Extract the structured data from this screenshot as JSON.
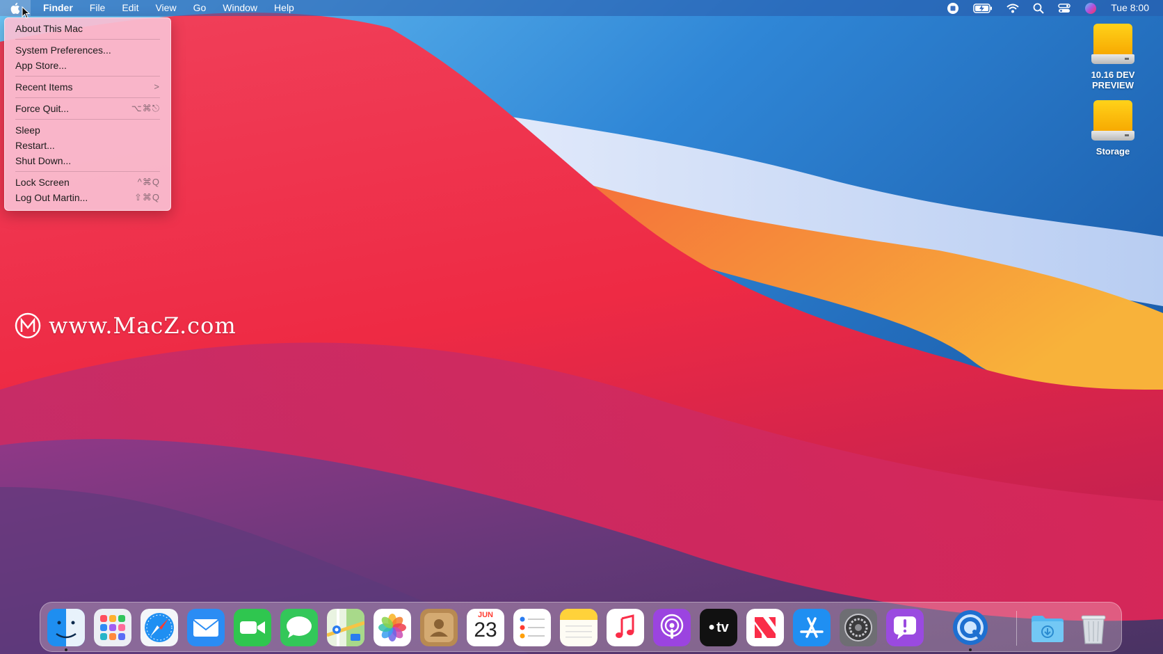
{
  "menubar": {
    "apple_icon": "apple-logo",
    "app_name": "Finder",
    "menus": [
      "File",
      "Edit",
      "View",
      "Go",
      "Window",
      "Help"
    ],
    "status_icons": [
      "record-icon",
      "battery-icon",
      "wifi-icon",
      "spotlight-search-icon",
      "control-center-icon",
      "siri-icon"
    ],
    "clock": "Tue 8:00"
  },
  "apple_menu": {
    "items": [
      {
        "label": "About This Mac",
        "shortcut": ""
      },
      {
        "label": "System Preferences...",
        "shortcut": ""
      },
      {
        "label": "App Store...",
        "shortcut": ""
      },
      {
        "label": "Recent Items",
        "shortcut": ">"
      },
      {
        "label": "Force Quit...",
        "shortcut": "⌥⌘⎋"
      },
      {
        "label": "Sleep",
        "shortcut": ""
      },
      {
        "label": "Restart...",
        "shortcut": ""
      },
      {
        "label": "Shut Down...",
        "shortcut": ""
      },
      {
        "label": "Lock Screen",
        "shortcut": "^⌘Q"
      },
      {
        "label": "Log Out Martin...",
        "shortcut": "⇧⌘Q"
      }
    ]
  },
  "desktop": {
    "drives": [
      {
        "label_line1": "10.16 DEV",
        "label_line2": "PREVIEW"
      },
      {
        "label_line1": "Storage",
        "label_line2": ""
      }
    ],
    "watermark": "www.MacZ.com"
  },
  "dock": {
    "apps": [
      "Finder",
      "Launchpad",
      "Safari",
      "Mail",
      "FaceTime",
      "Messages",
      "Maps",
      "Photos",
      "Contacts",
      "Calendar",
      "Reminders",
      "Notes",
      "Music",
      "Podcasts",
      "TV",
      "News",
      "App Store",
      "System Preferences",
      "Feedback Assistant",
      "QuickTime Player",
      "Downloads",
      "Trash"
    ],
    "calendar_month": "JUN",
    "calendar_day": "23",
    "tv_label": "tv"
  },
  "colors": {
    "menu_bg": "#fabed2",
    "wallpaper_blue": "#2a6fc4",
    "wallpaper_red": "#f0334a",
    "wallpaper_orange": "#f7a531"
  }
}
